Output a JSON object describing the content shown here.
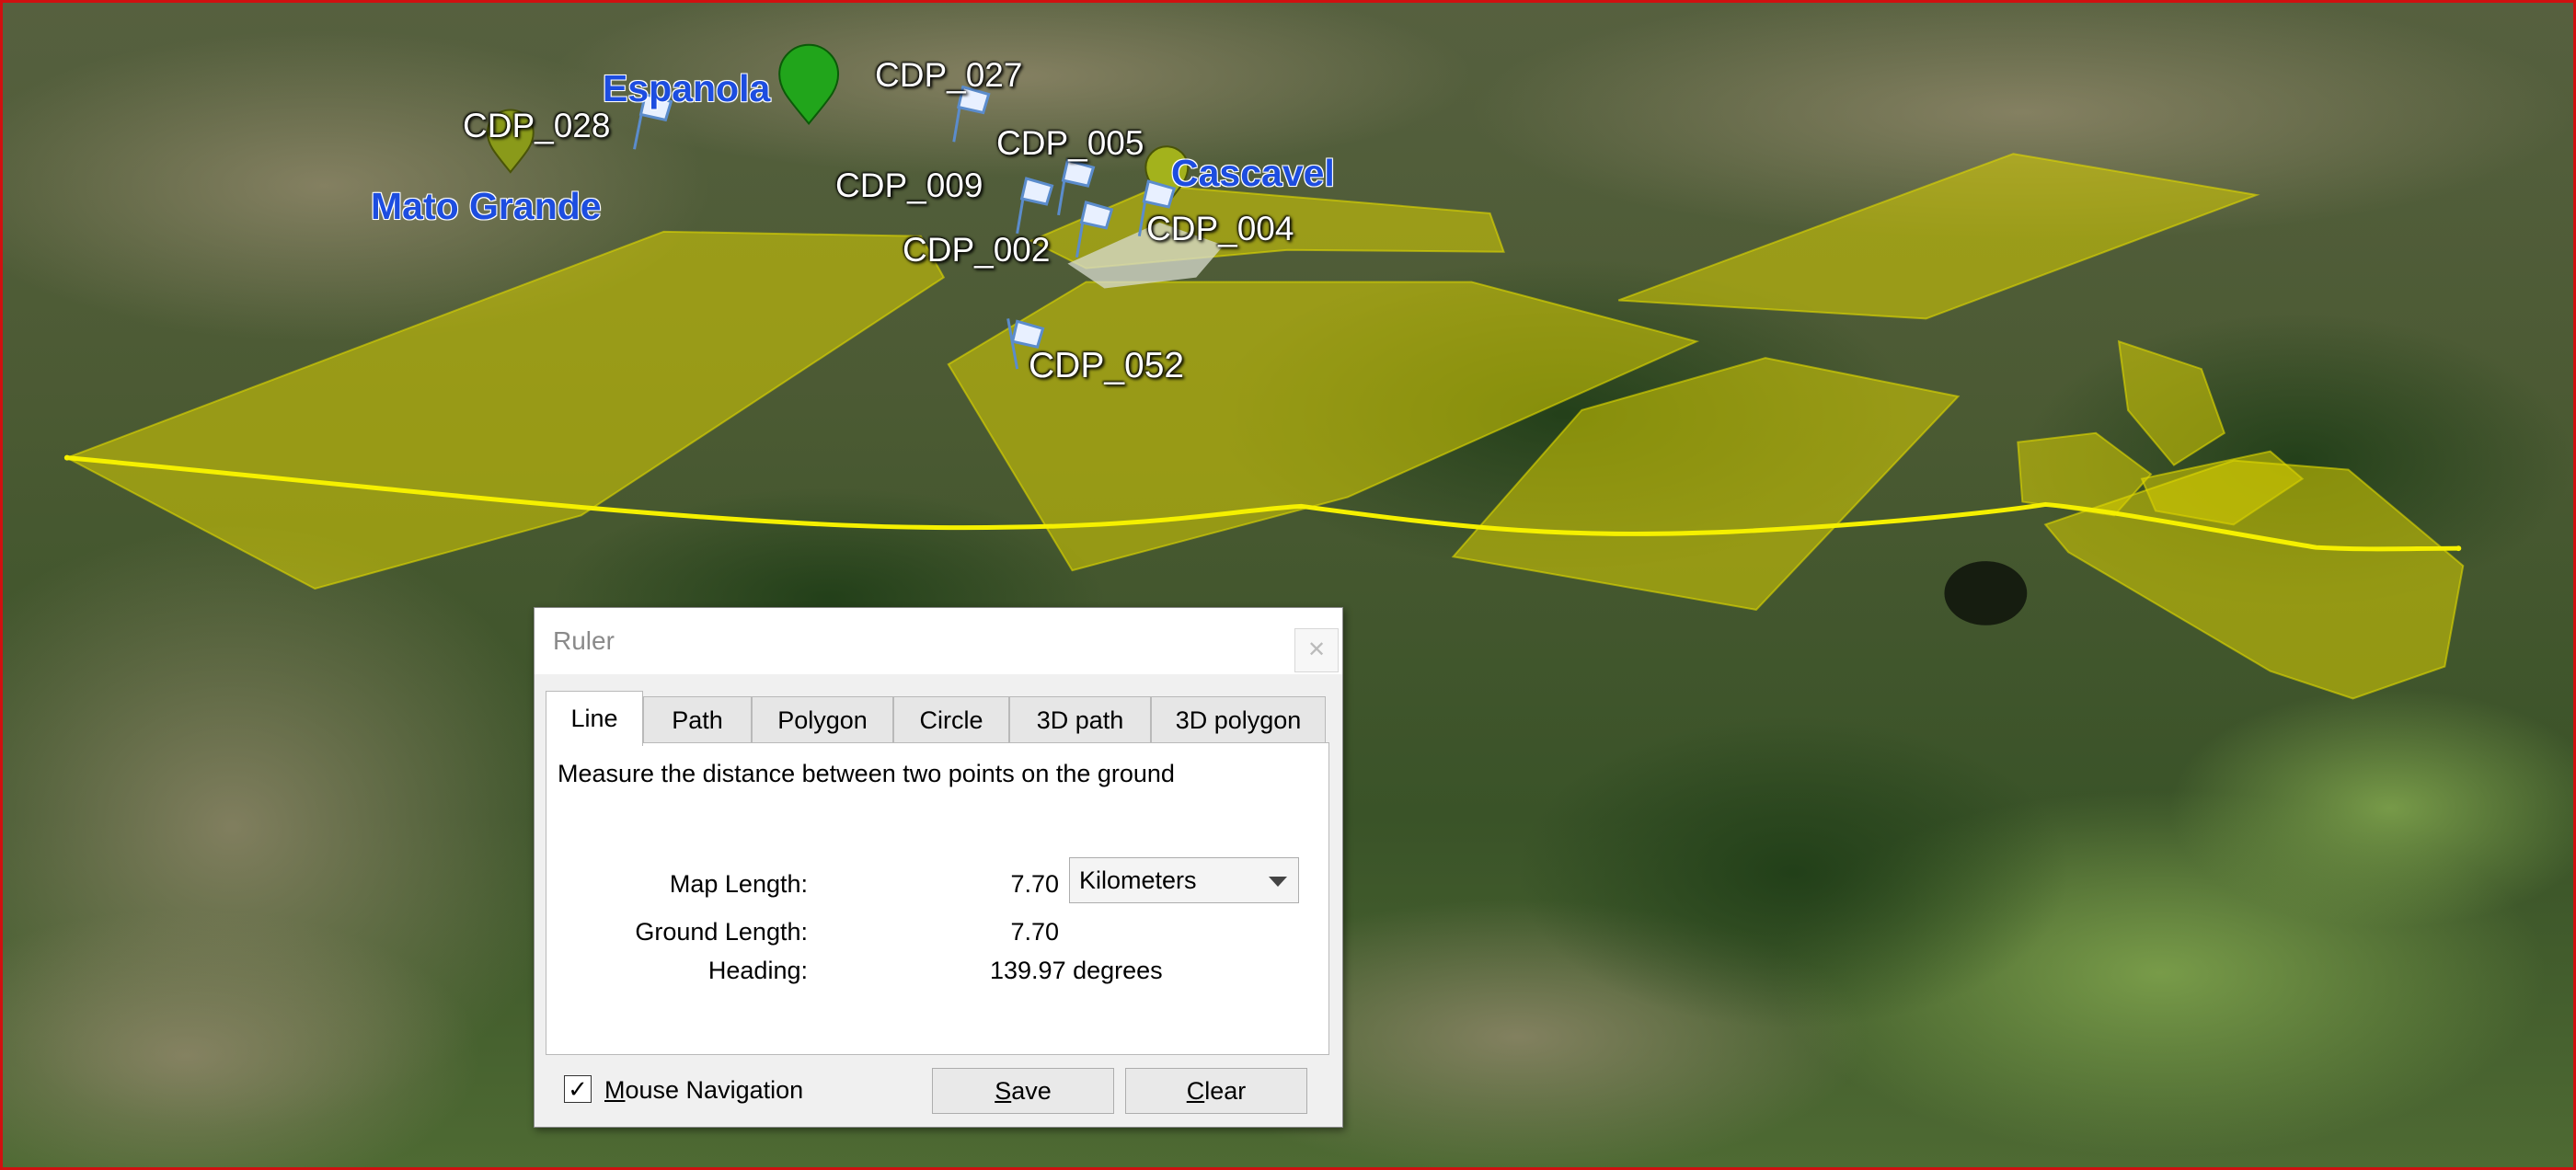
{
  "map": {
    "place_labels": [
      "Espanola",
      "Cascavel",
      "Mato Grande"
    ],
    "flag_labels": [
      "CDP_028",
      "CDP_027",
      "CDP_005",
      "CDP_009",
      "CDP_004",
      "CDP_002",
      "CDP_052"
    ],
    "line_color": "#f5f000",
    "polygon_color": "#d8d000",
    "pin_color": "#21a51b",
    "pin_olive_color": "#8a9a1a"
  },
  "ruler": {
    "title": "Ruler",
    "close_icon": "close-icon",
    "tabs": [
      "Line",
      "Path",
      "Polygon",
      "Circle",
      "3D path",
      "3D polygon"
    ],
    "active_tab": "Line",
    "description": "Measure the distance between two points on the ground",
    "map_length_label": "Map Length:",
    "map_length_value": "7.70",
    "units": "Kilometers",
    "ground_length_label": "Ground Length:",
    "ground_length_value": "7.70",
    "heading_label": "Heading:",
    "heading_value": "139.97 degrees",
    "mouse_navigation_checked": true,
    "mouse_navigation_check_glyph": "✓",
    "mouse_navigation_prefix": "M",
    "mouse_navigation_rest": "ouse Navigation",
    "save_prefix": "S",
    "save_rest": "ave",
    "clear_prefix": "C",
    "clear_rest": "lear"
  }
}
